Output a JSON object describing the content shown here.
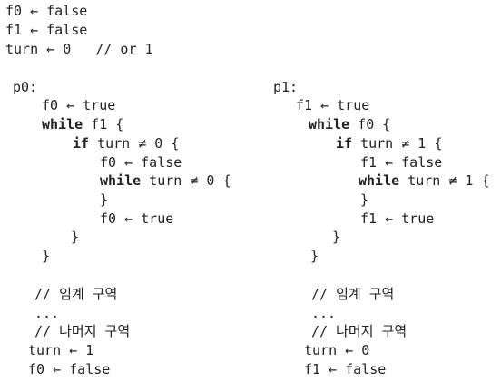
{
  "header": {
    "line1": "f0 ← false",
    "line2": "f1 ← false",
    "line3": "turn ← 0   // or 1"
  },
  "p0": {
    "label": "p0:",
    "set_flag": "f0 ← true",
    "while_kw": "while",
    "while_cond": " f1 {",
    "if_kw": "if",
    "if_cond": " turn ≠ 0 {",
    "clear_flag": "f0 ← false",
    "inner_while_kw": "while",
    "inner_while_cond": " turn ≠ 0 {",
    "inner_close": "}",
    "reset_flag": "f0 ← true",
    "if_close": "}",
    "while_close": "}",
    "critical_comment": "// 임계 구역",
    "ellipsis": "...",
    "remainder_comment": "// 나머지 구역",
    "set_turn": "turn ← 1",
    "release_flag": "f0 ← false"
  },
  "p1": {
    "label": "p1:",
    "set_flag": "f1 ← true",
    "while_kw": "while",
    "while_cond": " f0 {",
    "if_kw": "if",
    "if_cond": " turn ≠ 1 {",
    "clear_flag": "f1 ← false",
    "inner_while_kw": "while",
    "inner_while_cond": " turn ≠ 1 {",
    "inner_close": "}",
    "reset_flag": "f1 ← true",
    "if_close": "}",
    "while_close": "}",
    "critical_comment": "// 임계 구역",
    "ellipsis": "...",
    "remainder_comment": "// 나머지 구역",
    "set_turn": "turn ← 0",
    "release_flag": "f1 ← false"
  }
}
